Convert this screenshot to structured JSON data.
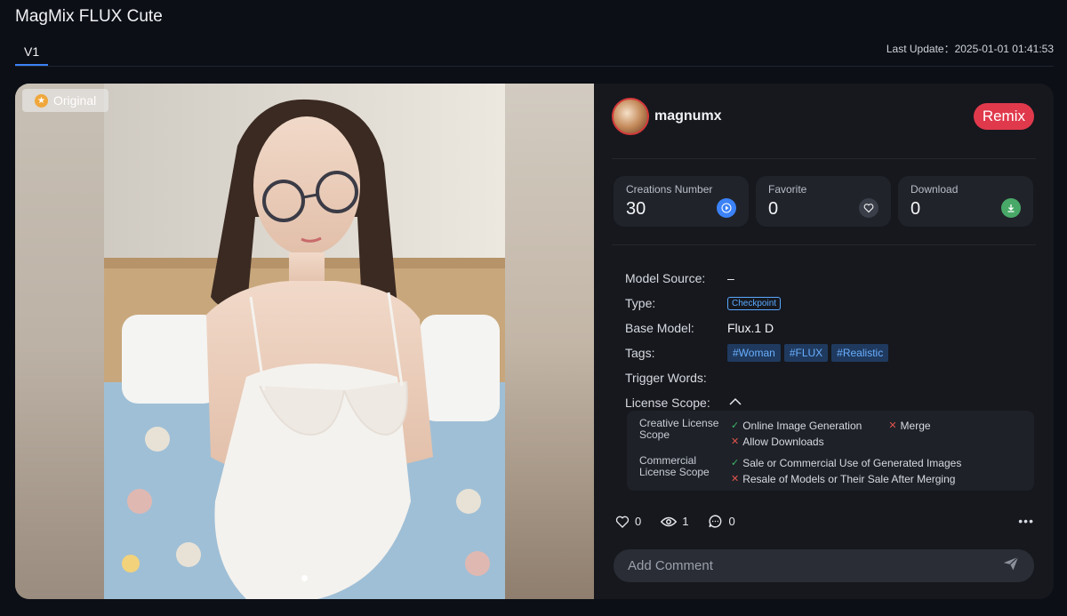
{
  "page": {
    "title": "MagMix FLUX Cute",
    "tabs": [
      {
        "label": "V1"
      }
    ],
    "last_update": "Last Update：2025-01-01 01:41:53"
  },
  "image": {
    "badge": "Original",
    "badge_icon": "star-icon",
    "dots": 1
  },
  "author": {
    "name": "magnumx",
    "remix_label": "Remix"
  },
  "stats": [
    {
      "label": "Creations Number",
      "value": "30",
      "icon": "play-icon"
    },
    {
      "label": "Favorite",
      "value": "0",
      "icon": "heart-icon"
    },
    {
      "label": "Download",
      "value": "0",
      "icon": "download-icon"
    }
  ],
  "props": {
    "model_source_label": "Model Source:",
    "model_source_value": "–",
    "type_label": "Type:",
    "type_value": "Checkpoint",
    "base_model_label": "Base Model:",
    "base_model_value": "Flux.1 D",
    "tags_label": "Tags:",
    "tags": [
      "#Woman",
      "#FLUX",
      "#Realistic"
    ],
    "trigger_words_label": "Trigger Words:",
    "license_scope_label": "License Scope:"
  },
  "license": {
    "creative_label": "Creative License Scope",
    "creative_items": [
      {
        "text": "Online Image Generation",
        "allowed": true
      },
      {
        "text": "Merge",
        "allowed": false
      },
      {
        "text": "Allow Downloads",
        "allowed": false
      }
    ],
    "commercial_label": "Commercial License Scope",
    "commercial_items": [
      {
        "text": "Sale or Commercial Use of Generated Images",
        "allowed": true
      },
      {
        "text": "Resale of Models or Their Sale After Merging",
        "allowed": false
      }
    ]
  },
  "actions": {
    "likes": "0",
    "views": "1",
    "comments": "0"
  },
  "comment": {
    "placeholder": "Add Comment"
  },
  "colors": {
    "background": "#0c0f16",
    "accent": "#3b82f6",
    "remix": "#e0394c",
    "tag": "#6aaeff",
    "ok": "#3fb868",
    "no": "#e0534c"
  }
}
